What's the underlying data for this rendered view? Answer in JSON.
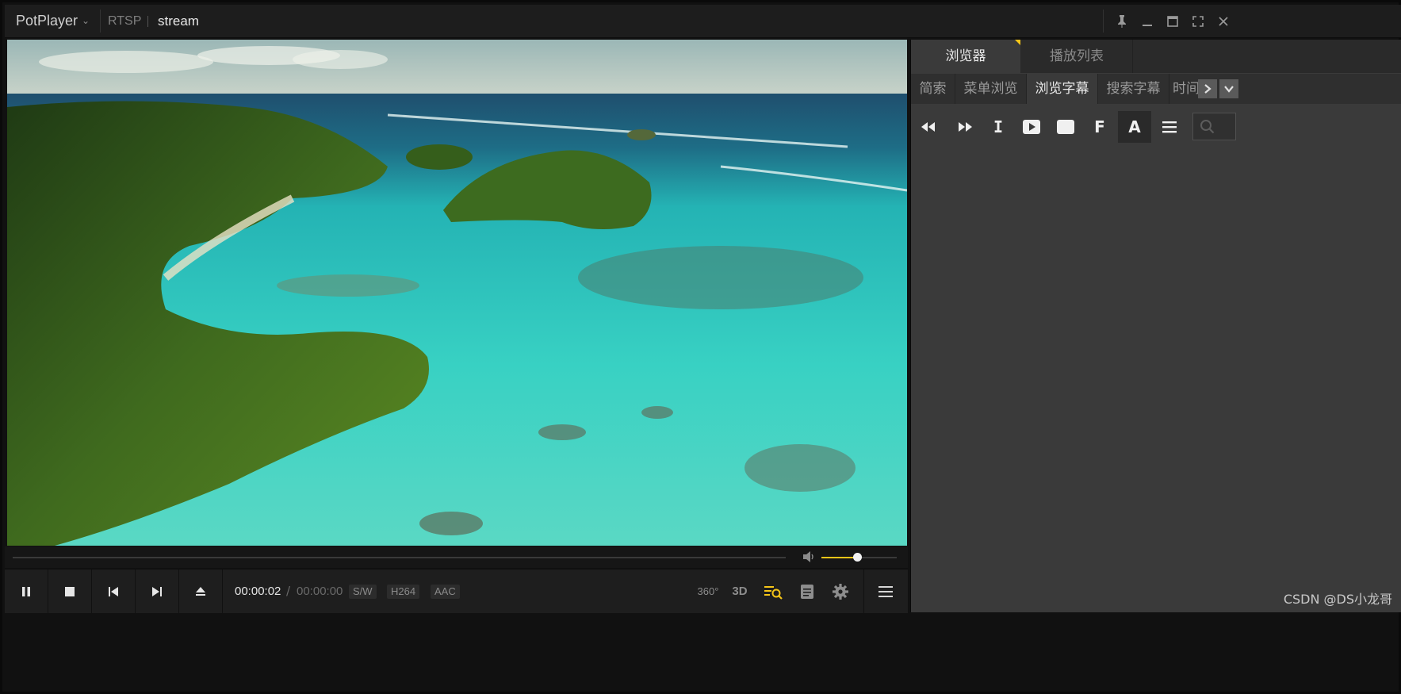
{
  "titlebar": {
    "app_name": "PotPlayer",
    "protocol": "RTSP",
    "stream_name": "stream"
  },
  "playback": {
    "current_time": "00:00:02",
    "separator": "/",
    "total_time": "00:00:00",
    "decoder": "S/W",
    "video_codec": "H264",
    "audio_codec": "AAC",
    "volume_level": 0.47,
    "seek_progress": 0
  },
  "right_icons": {
    "vr": "360°",
    "threed": "3D"
  },
  "panel": {
    "tabs": [
      {
        "label": "浏览器",
        "active": true
      },
      {
        "label": "播放列表",
        "active": false
      }
    ],
    "subtabs": [
      {
        "label": "简索",
        "active": false
      },
      {
        "label": "菜单浏览",
        "active": false
      },
      {
        "label": "浏览字幕",
        "active": true
      },
      {
        "label": "搜索字幕",
        "active": false
      },
      {
        "label": "时间",
        "active": false
      }
    ],
    "toolbar_letters": {
      "i": "I",
      "f": "F",
      "a": "A"
    }
  },
  "watermark": "CSDN @DS小龙哥",
  "colors": {
    "accent": "#f5c518",
    "panel_bg": "#3a3a3a",
    "titlebar_bg": "#1d1d1d"
  },
  "icons": [
    "pin-icon",
    "minimize-icon",
    "maximize-icon",
    "fullscreen-icon",
    "close-icon",
    "pause-icon",
    "stop-icon",
    "previous-icon",
    "next-icon",
    "eject-icon",
    "volume-icon",
    "vr360-icon",
    "3d-icon",
    "search-subtitle-icon",
    "playlist-doc-icon",
    "settings-gear-icon",
    "menu-icon",
    "rewind-icon",
    "fast-forward-icon",
    "play-box-icon",
    "square-icon",
    "list-icon",
    "search-icon"
  ]
}
